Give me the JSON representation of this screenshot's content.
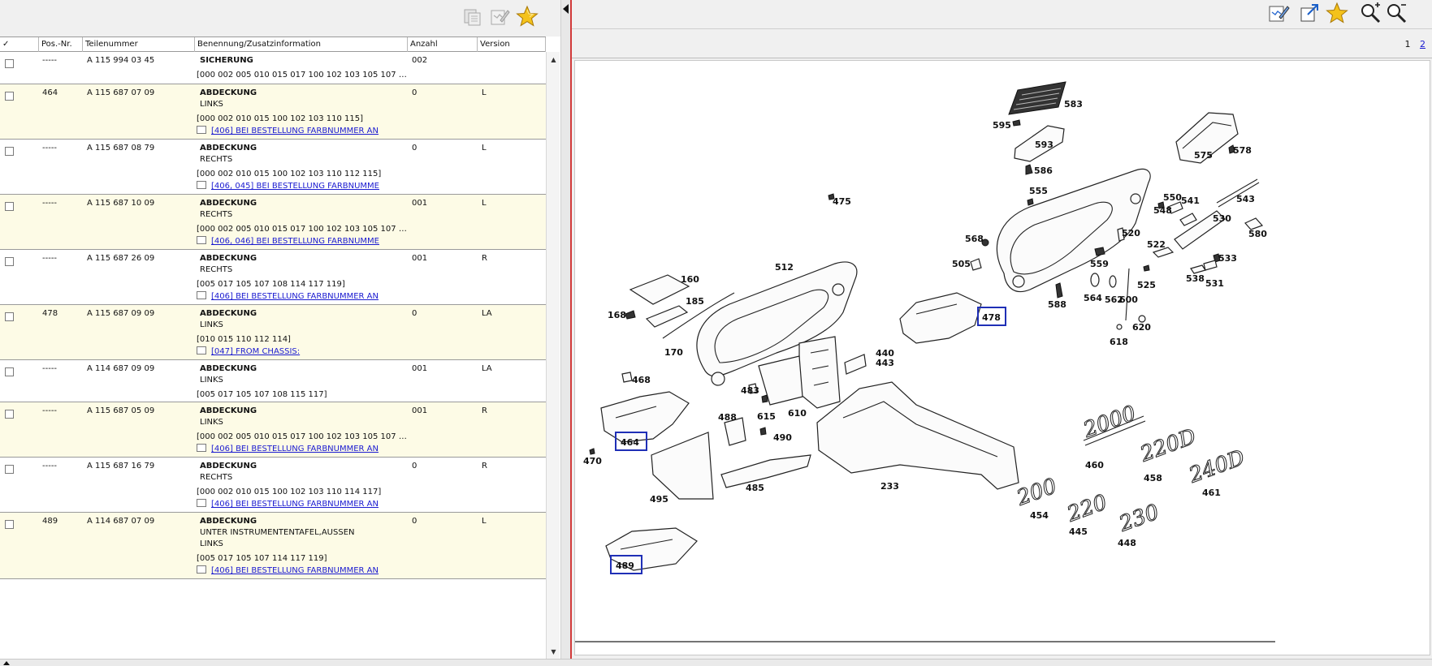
{
  "left_toolbar": {
    "buttons": [
      {
        "name": "copy-button",
        "icon": "copy-icon"
      },
      {
        "name": "edit-notes-button",
        "icon": "edit-notes-icon"
      },
      {
        "name": "favorite-button",
        "icon": "star-icon"
      }
    ]
  },
  "table": {
    "headers": {
      "check": "✓",
      "pos": "Pos.-Nr.",
      "teil": "Teilenummer",
      "benennung": "Benennung/Zusatzinformation",
      "anzahl": "Anzahl",
      "version": "Version"
    },
    "rows": [
      {
        "pos": "-----",
        "teil": "A 115 994 03 45",
        "name": "SICHERUNG",
        "desc": [],
        "codes": "[000 002 005 010 015 017 100 102 103 105 107 10...",
        "note": "",
        "anzahl": "002",
        "version": ""
      },
      {
        "pos": "464",
        "teil": "A 115 687 07 09",
        "name": "ABDECKUNG",
        "desc": [
          "LINKS"
        ],
        "codes": "[000 002 010 015 100 102 103 110 115]",
        "note": "[406] BEI BESTELLUNG FARBNUMMER AN",
        "anzahl": "0",
        "version": "L"
      },
      {
        "pos": "-----",
        "teil": "A 115 687 08 79",
        "name": "ABDECKUNG",
        "desc": [
          "RECHTS"
        ],
        "codes": "[000 002 010 015 100 102 103 110 112 115]",
        "note": "[406, 045] BEI BESTELLUNG FARBNUMME",
        "anzahl": "0",
        "version": "L"
      },
      {
        "pos": "-----",
        "teil": "A 115 687 10 09",
        "name": "ABDECKUNG",
        "desc": [
          "RECHTS"
        ],
        "codes": "[000 002 005 010 015 017 100 102 103 105 107 10...",
        "note": "[406, 046] BEI BESTELLUNG FARBNUMME",
        "anzahl": "001",
        "version": "L"
      },
      {
        "pos": "-----",
        "teil": "A 115 687 26 09",
        "name": "ABDECKUNG",
        "desc": [
          "RECHTS"
        ],
        "codes": "[005 017 105 107 108 114 117 119]",
        "note": "[406] BEI BESTELLUNG FARBNUMMER AN",
        "anzahl": "001",
        "version": "R"
      },
      {
        "pos": "478",
        "teil": "A 115 687 09 09",
        "name": "ABDECKUNG",
        "desc": [
          "LINKS"
        ],
        "codes": "[010 015 110 112 114]",
        "note": "[047] FROM CHASSIS:",
        "anzahl": "0",
        "version": "LA"
      },
      {
        "pos": "-----",
        "teil": "A 114 687 09 09",
        "name": "ABDECKUNG",
        "desc": [
          "LINKS"
        ],
        "codes": "[005 017 105 107 108 115 117]",
        "note": "",
        "anzahl": "001",
        "version": "LA"
      },
      {
        "pos": "-----",
        "teil": "A 115 687 05 09",
        "name": "ABDECKUNG",
        "desc": [
          "LINKS"
        ],
        "codes": "[000 002 005 010 015 017 100 102 103 105 107 10...",
        "note": "[406] BEI BESTELLUNG FARBNUMMER AN",
        "anzahl": "001",
        "version": "R"
      },
      {
        "pos": "-----",
        "teil": "A 115 687 16 79",
        "name": "ABDECKUNG",
        "desc": [
          "RECHTS"
        ],
        "codes": "[000 002 010 015 100 102 103 110 114 117]",
        "note": "[406] BEI BESTELLUNG FARBNUMMER AN",
        "anzahl": "0",
        "version": "R"
      },
      {
        "pos": "489",
        "teil": "A 114 687 07 09",
        "name": "ABDECKUNG",
        "desc": [
          "UNTER INSTRUMENTENTAFEL,AUSSEN",
          "LINKS"
        ],
        "codes": "[005 017 105 107 114 117 119]",
        "note": "[406] BEI BESTELLUNG FARBNUMMER AN",
        "anzahl": "0",
        "version": "L"
      }
    ]
  },
  "right_toolbar": {
    "buttons": [
      {
        "name": "edit-notes-button",
        "icon": "edit-notes-icon"
      },
      {
        "name": "open-external-button",
        "icon": "open-external-icon"
      },
      {
        "name": "favorite-button",
        "icon": "star-icon"
      },
      {
        "name": "zoom-in-button",
        "icon": "zoom-in-icon"
      },
      {
        "name": "zoom-out-button",
        "icon": "zoom-out-icon"
      }
    ]
  },
  "pager": {
    "current": "1",
    "next": "2"
  },
  "diagram": {
    "labels": {
      "l583": "583",
      "l595": "595",
      "l593": "593",
      "l575": "575",
      "l578": "578",
      "l586": "586",
      "l475": "475",
      "l555": "555",
      "l548": "548",
      "l550": "550",
      "l541": "541",
      "l543": "543",
      "l530": "530",
      "l580": "580",
      "l568": "568",
      "l520": "520",
      "l522": "522",
      "l505": "505",
      "l559": "559",
      "l533": "533",
      "l525": "525",
      "l538": "538",
      "l531": "531",
      "l564": "564",
      "l562": "562",
      "l600": "600",
      "l588": "588",
      "l620": "620",
      "l618": "618",
      "l478": "478",
      "l512": "512",
      "l160": "160",
      "l185": "185",
      "l168": "168",
      "l170": "170",
      "l440": "440",
      "l443": "443",
      "l468": "468",
      "l483": "483",
      "l615": "615",
      "l610": "610",
      "l488": "488",
      "l490": "490",
      "l464": "464",
      "l470": "470",
      "l495": "495",
      "l485": "485",
      "l233": "233",
      "l460": "460",
      "l458": "458",
      "l461": "461",
      "l454": "454",
      "l445": "445",
      "l448": "448",
      "l489": "489"
    },
    "badges": {
      "b2000": "2000",
      "b220d": "220D",
      "b240d": "240D",
      "b200": "200",
      "b220": "220",
      "b230": "230"
    },
    "highlighted_callouts": [
      "478",
      "464",
      "489"
    ],
    "highlight_color": "#1f2fb6"
  },
  "colors": {
    "row_alt": "#fdfbe6",
    "link": "#1a1ad0",
    "splitter_accent": "#d23a3a"
  }
}
